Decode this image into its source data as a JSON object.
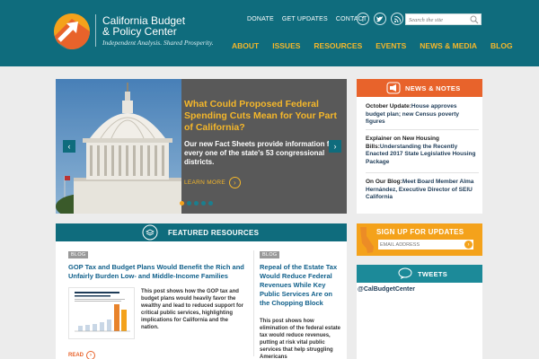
{
  "brand": {
    "name_line1": "California Budget",
    "name_line2": "& Policy Center",
    "tagline": "Independent Analysis. Shared Prosperity."
  },
  "top_links": [
    "DONATE",
    "GET UPDATES",
    "CONTACT"
  ],
  "search": {
    "placeholder": "Search the site"
  },
  "nav": [
    "ABOUT",
    "ISSUES",
    "RESOURCES",
    "EVENTS",
    "NEWS & MEDIA",
    "BLOG"
  ],
  "hero": {
    "headline": "What Could Proposed Federal Spending Cuts Mean for Your Part of California?",
    "body": "Our new Fact Sheets provide information for every one of the state's 53 congressional districts.",
    "cta": "LEARN MORE",
    "slide_count": 5,
    "active_slide": 1
  },
  "news": {
    "title": "NEWS & NOTES",
    "items": [
      {
        "lead": "October Update:",
        "text": "House approves budget plan; new Census poverty figures"
      },
      {
        "lead": "Explainer on New Housing Bills:",
        "text": "Understanding the Recently Enacted 2017 State Legislative Housing Package"
      },
      {
        "lead": "On Our Blog:",
        "text": "Meet Board Member Alma Hernández, Executive Director of SEIU California"
      }
    ]
  },
  "signup": {
    "title": "SIGN UP FOR UPDATES",
    "placeholder": "EMAIL ADDRESS"
  },
  "tweets": {
    "title": "TWEETS",
    "handle": "@CalBudgetCenter"
  },
  "featured": {
    "title": "FEATURED RESOURCES",
    "cards": [
      {
        "tag": "BLOG",
        "title": "GOP Tax and Budget Plans Would Benefit the Rich and Unfairly Burden Low- and Middle-Income Families",
        "text": "This post shows how the GOP tax and budget plans would heavily favor the wealthy and lead to reduced support for critical public services, highlighting implications for California and the nation.",
        "cta": "READ"
      },
      {
        "tag": "BLOG",
        "title": "Repeal of the Estate Tax Would Reduce Federal Revenues While Key Public Services Are on the Chopping Block",
        "text": "This post shows how elimination of the federal estate tax would reduce revenues, putting at risk vital public services that help struggling Americans"
      }
    ]
  },
  "colors": {
    "header": "#0f6c7d",
    "accent": "#f5b72a",
    "news": "#e8632b",
    "signup": "#f4a21b",
    "tweets": "#1c8a99"
  }
}
